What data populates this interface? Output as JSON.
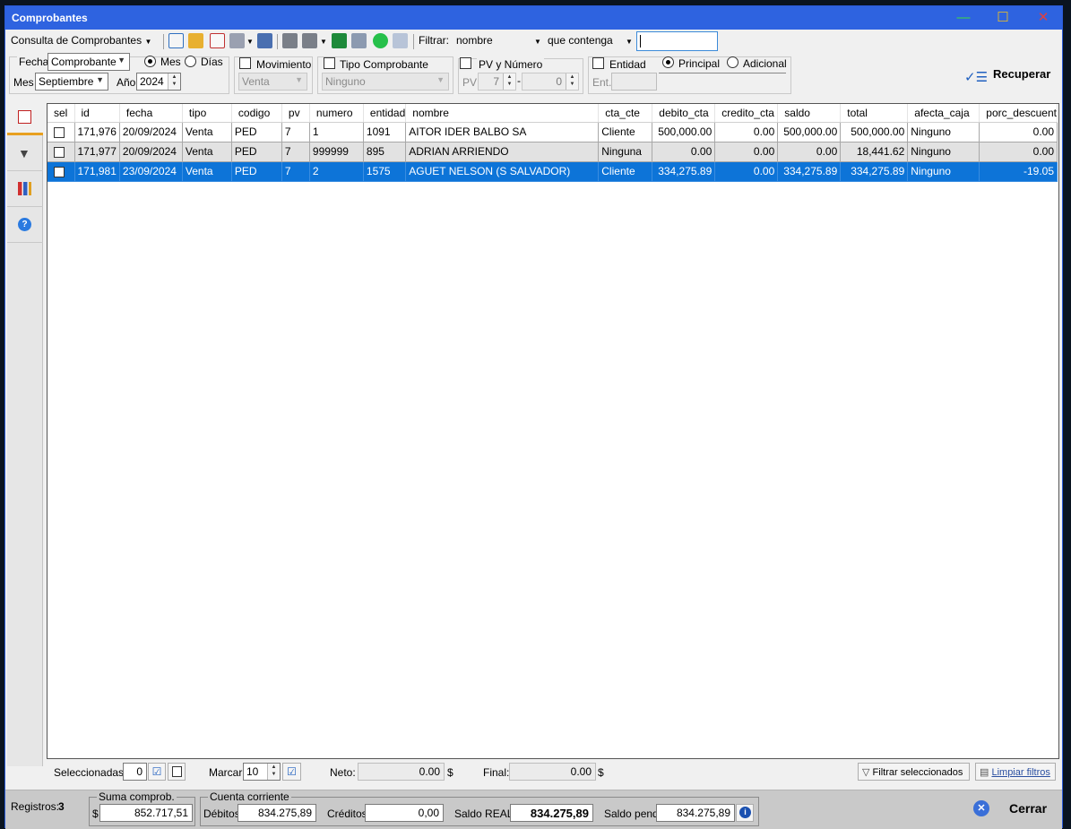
{
  "window": {
    "title": "Comprobantes"
  },
  "toolbar": {
    "consulta": "Consulta de Comprobantes",
    "filtrar_label": "Filtrar:",
    "filtrar_field": "nombre",
    "filtrar_op": "que contenga",
    "filtrar_value": "",
    "icons": [
      "new-doc-icon",
      "open-folder-icon",
      "pdf-icon",
      "export-icon",
      "email-icon",
      "print-icon",
      "print-options-icon",
      "excel-icon",
      "copy-icon",
      "whatsapp-icon",
      "duplicate-icon"
    ]
  },
  "filters": {
    "fecha_label": "Fecha",
    "fecha_value": "Comprobante",
    "mes_radio": "Mes",
    "dias_radio": "Días",
    "mes_label": "Mes",
    "mes_value": "Septiembre",
    "anio_label": "Año",
    "anio_value": "2024",
    "movimiento_label": "Movimiento",
    "movimiento_value": "Venta",
    "tipo_label": "Tipo Comprobante",
    "tipo_value": "Ninguno",
    "pv_label": "PV y Número",
    "pv_short": "PV",
    "pv_value": "7",
    "numero_value": "0",
    "entidad_label": "Entidad",
    "principal_label": "Principal",
    "adicional_label": "Adicional",
    "ent_label": "Ent.",
    "recuperar": "Recuperar"
  },
  "grid": {
    "columns": [
      "sel",
      "id",
      "fecha",
      "tipo",
      "codigo",
      "pv",
      "numero",
      "entidad",
      "nombre",
      "cta_cte",
      "debito_cta",
      "credito_cta",
      "saldo",
      "total",
      "afecta_caja",
      "porc_descuent"
    ],
    "rows": [
      [
        "",
        "171,976",
        "20/09/2024",
        "Venta",
        "PED",
        "7",
        "1",
        "1091",
        "AITOR IDER BALBO SA",
        "Cliente",
        "500,000.00",
        "0.00",
        "500,000.00",
        "500,000.00",
        "Ninguno",
        "0.00"
      ],
      [
        "",
        "171,977",
        "20/09/2024",
        "Venta",
        "PED",
        "7",
        "999999",
        "895",
        "ADRIAN ARRIENDO",
        "Ninguna",
        "0.00",
        "0.00",
        "0.00",
        "18,441.62",
        "Ninguno",
        "0.00"
      ],
      [
        "",
        "171,981",
        "23/09/2024",
        "Venta",
        "PED",
        "7",
        "2",
        "1575",
        "AGUET NELSON (S SALVADOR)",
        "Cliente",
        "334,275.89",
        "0.00",
        "334,275.89",
        "334,275.89",
        "Ninguno",
        "-19.05"
      ]
    ]
  },
  "bottom": {
    "seleccionadas_label": "Seleccionadas:",
    "seleccionadas_value": "0",
    "marcar_label": "Marcar:",
    "marcar_value": "10",
    "neto_label": "Neto:",
    "neto_value": "0.00",
    "final_label": "Final:",
    "final_value": "0.00",
    "currency": "$",
    "filtrar_sel": "Filtrar seleccionados",
    "limpiar": "Limpiar filtros"
  },
  "status": {
    "registros_label": "Registros:",
    "registros_value": "3",
    "suma_legend": "Suma comprob.",
    "suma_currency": "$",
    "suma_value": "852.717,51",
    "cc_legend": "Cuenta corriente",
    "debitos_label": "Débitos",
    "debitos_value": "834.275,89",
    "creditos_label": "Créditos",
    "creditos_value": "0,00",
    "saldo_real_label": "Saldo REAL",
    "saldo_real_value": "834.275,89",
    "saldo_pend_label": "Saldo pend.",
    "saldo_pend_value": "834.275,89",
    "cerrar": "Cerrar"
  }
}
